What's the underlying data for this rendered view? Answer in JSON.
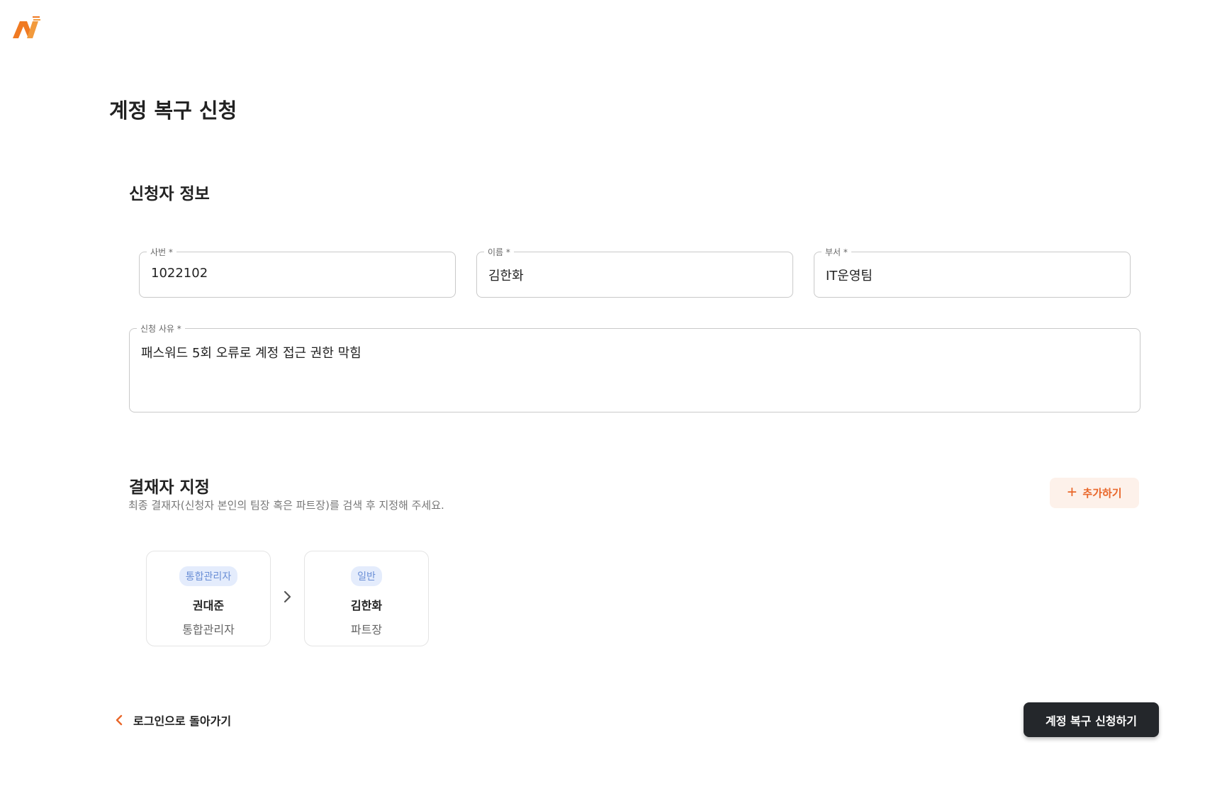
{
  "brand": {
    "logo_icon": "orange-n-logo",
    "accent_color": "#e9672a"
  },
  "page": {
    "title": "계정 복구 신청"
  },
  "applicant": {
    "section_title": "신청자 정보",
    "employee_id": {
      "label": "사번 *",
      "value": "1022102"
    },
    "name": {
      "label": "이름 *",
      "value": "김한화"
    },
    "department": {
      "label": "부서 *",
      "value": "IT운영팀"
    },
    "reason": {
      "label": "신청 사유 *",
      "value": "패스워드 5회 오류로 계정 접근 권한 막힘"
    }
  },
  "approvers": {
    "section_title": "결재자 지정",
    "helper": "최종 결재자(신청자 본인의 팀장 혹은 파트장)를 검색 후 지정해 주세요.",
    "add_label": "추가하기",
    "items": [
      {
        "badge": "통합관리자",
        "name": "권대준",
        "role": "통합관리자"
      },
      {
        "badge": "일반",
        "name": "김한화",
        "role": "파트장"
      }
    ]
  },
  "footer": {
    "back_label": "로그인으로 돌아가기",
    "submit_label": "계정 복구 신청하기"
  }
}
